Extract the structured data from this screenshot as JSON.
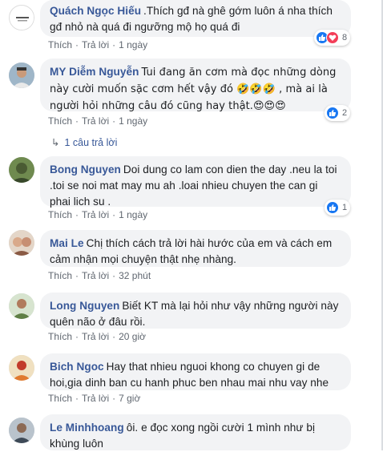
{
  "actions": {
    "like": "Thích",
    "reply": "Trả lời",
    "sep": "·"
  },
  "comments": [
    {
      "name": "Quách Ngọc Hiếu",
      "text": ".Thích gđ nà ghê gớm luôn á nha thích gđ nhỏ nà quá đi ngưỡng mộ họ quá đi",
      "time": "1 ngày",
      "reaction_count": "8"
    },
    {
      "name": "MY Diễm Nguyễn",
      "text": "Tui đang ăn cơm mà đọc những dòng này cười muốn sặc cơm hết vậy đó 🤣🤣🤣 , mà ai là người hỏi những câu đó cũng hay thật.😍😍😍",
      "time": "1 ngày",
      "reaction_count": "2",
      "replies": "1 câu trả lời"
    },
    {
      "name": "Bong Nguyen",
      "text": "Doi dung co lam con dien the day .neu la toi .toi se noi mat may mu ah .loai nhieu chuyen the can gi phai lich su .",
      "time": "1 ngày",
      "reaction_count": "1"
    },
    {
      "name": "Mai Le",
      "text": "Chị thích cách trả lời hài hước của em và cách em cảm nhận mọi chuyện thật nhẹ nhàng.",
      "time": "32 phút"
    },
    {
      "name": "Long Nguyen",
      "text": "Biết KT mà lại hỏi như vậy những người này quên não ở đâu rồi.",
      "time": "20 giờ"
    },
    {
      "name": "Bich Ngoc",
      "text": "Hay that nhieu nguoi khong co chuyen gi de hoi,gia dinh ban cu hanh phuc ben nhau mai nhu vay nhe",
      "time": "7 giờ"
    },
    {
      "name": "Le Minhhoang",
      "text": "ôi. e đọc xong ngồi cười 1 mình như bị khùng luôn"
    }
  ]
}
